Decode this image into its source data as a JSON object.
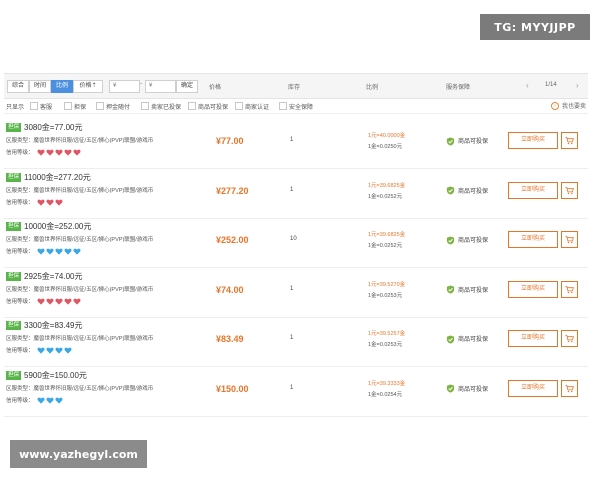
{
  "watermarks": {
    "top": "TG: MYYJJPP",
    "bottom": "www.yazhegyl.com"
  },
  "toolbar": {
    "sort_tabs": [
      "综合",
      "时间",
      "比例",
      "价格⇡"
    ],
    "active_sort": 2,
    "min_placeholder": "¥",
    "max_placeholder": "¥",
    "range_separator": "-",
    "confirm_label": "确定"
  },
  "columns": {
    "price": "价格",
    "stock": "库存",
    "ratio": "比例",
    "service": "服务保障"
  },
  "pagination": {
    "prev": "‹",
    "next": "›",
    "info": "1/14"
  },
  "filters": {
    "label": "只显示",
    "options": [
      "客服",
      "担保",
      "押金随付",
      "卖家已投保",
      "商品可投保",
      "商家认证",
      "安全保障"
    ],
    "my_attention": "我也要卖"
  },
  "listing_common": {
    "badge": "担保",
    "region_prefix": "区服类型：",
    "credit_label": "信用等级：",
    "buy_label": "立即购买"
  },
  "colors": {
    "accent": "#e8742a",
    "badge": "#59b54a",
    "heart_red": "#e05562",
    "heart_blue": "#3aa7e6"
  },
  "listings": [
    {
      "title": "3080金=77.00元",
      "region": "魔兽世界怀旧服/远征/五区/狮心(PVP)联盟/游戏币",
      "heart_color": "red",
      "hearts": 5,
      "price": "¥77.00",
      "stock": "1",
      "ratio": "1元=40.0000金",
      "unit": "1金=0.0250元",
      "service": "商品可投保"
    },
    {
      "title": "11000金=277.20元",
      "region": "魔兽世界怀旧服/远征/五区/狮心(PVP)联盟/游戏币",
      "heart_color": "red",
      "hearts": 3,
      "price": "¥277.20",
      "stock": "1",
      "ratio": "1元=39.6825金",
      "unit": "1金=0.0252元",
      "service": "商品可投保"
    },
    {
      "title": "10000金=252.00元",
      "region": "魔兽世界怀旧服/远征/五区/狮心(PVP)联盟/游戏币",
      "heart_color": "blue",
      "hearts": 5,
      "price": "¥252.00",
      "stock": "10",
      "ratio": "1元=39.6825金",
      "unit": "1金=0.0252元",
      "service": "商品可投保"
    },
    {
      "title": "2925金=74.00元",
      "region": "魔兽世界怀旧服/远征/五区/狮心(PVP)联盟/游戏币",
      "heart_color": "red",
      "hearts": 5,
      "price": "¥74.00",
      "stock": "1",
      "ratio": "1元=39.5270金",
      "unit": "1金=0.0253元",
      "service": "商品可投保"
    },
    {
      "title": "3300金=83.49元",
      "region": "魔兽世界怀旧服/远征/五区/狮心(PVP)联盟/游戏币",
      "heart_color": "blue",
      "hearts": 4,
      "price": "¥83.49",
      "stock": "1",
      "ratio": "1元=39.5257金",
      "unit": "1金=0.0253元",
      "service": "商品可投保"
    },
    {
      "title": "5900金=150.00元",
      "region": "魔兽世界怀旧服/远征/五区/狮心(PVP)联盟/游戏币",
      "heart_color": "blue",
      "hearts": 3,
      "price": "¥150.00",
      "stock": "1",
      "ratio": "1元=39.3333金",
      "unit": "1金=0.0254元",
      "service": "商品可投保"
    }
  ]
}
